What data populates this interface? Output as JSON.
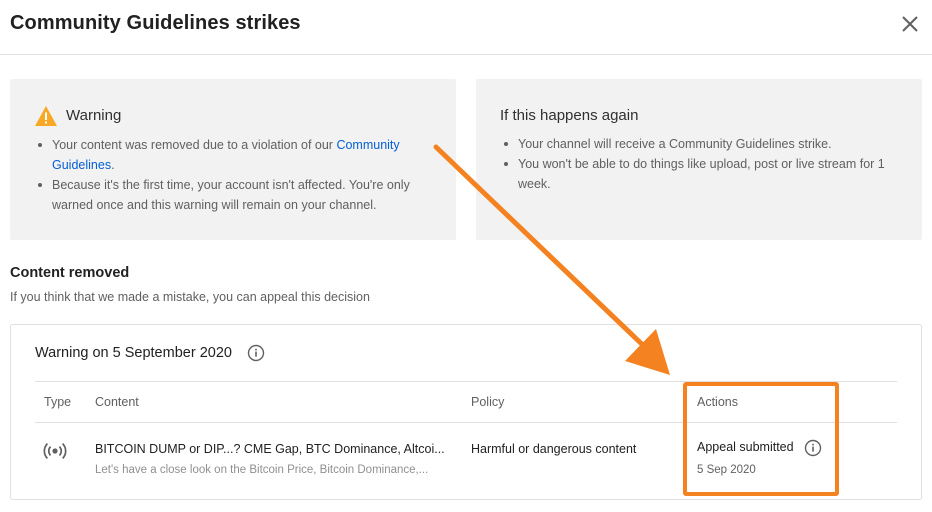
{
  "dialog": {
    "title": "Community Guidelines strikes",
    "close_icon": "close-icon"
  },
  "warning_card": {
    "icon": "warning-triangle-icon",
    "icon_color": "#f9a825",
    "heading": "Warning",
    "bullet1_text": "Your content was removed due to a violation of our ",
    "bullet1_link": "Community Guidelines",
    "bullet1_end": ".",
    "bullet2": "Because it's the first time, your account isn't affected. You're only warned once and this warning will remain on your channel."
  },
  "again_card": {
    "heading": "If this happens again",
    "bullet1": "Your channel will receive a Community Guidelines strike.",
    "bullet2": "You won't be able to do things like upload, post or live stream for 1 week."
  },
  "content_removed": {
    "title": "Content removed",
    "subtitle": "If you think that we made a mistake, you can appeal this decision"
  },
  "warning_panel": {
    "title": "Warning on 5 September 2020",
    "info_icon": "info-icon",
    "columns": {
      "type": "Type",
      "content": "Content",
      "policy": "Policy",
      "actions": "Actions"
    },
    "row": {
      "type_icon": "live-broadcast-icon",
      "content_title": "BITCOIN DUMP or DIP...? CME Gap, BTC Dominance, Altcoi...",
      "content_desc": "Let's have a close look on the Bitcoin Price, Bitcoin Dominance,...",
      "policy": "Harmful or dangerous content",
      "status": "Appeal submitted",
      "status_icon": "info-icon",
      "date": "5 Sep 2020"
    }
  },
  "annotation": {
    "color": "#f58220",
    "shapes": [
      "arrow",
      "highlight-box"
    ]
  },
  "colors": {
    "link": "#065fd4",
    "card_bg": "#f2f2f2",
    "divider": "#e0e0e0"
  }
}
